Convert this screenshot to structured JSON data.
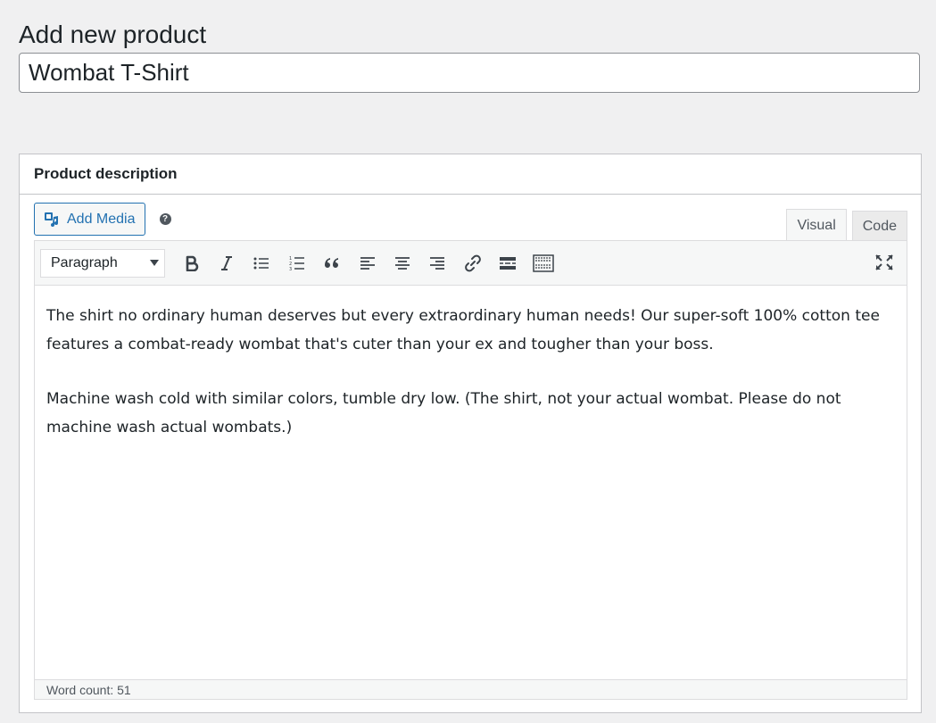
{
  "page": {
    "title": "Add new product"
  },
  "product": {
    "name": "Wombat T-Shirt"
  },
  "description_box": {
    "title": "Product description",
    "add_media_label": "Add Media",
    "help_icon_glyph": "?",
    "tabs": [
      {
        "label": "Visual",
        "active": true
      },
      {
        "label": "Code",
        "active": false
      }
    ],
    "format_select_value": "Paragraph",
    "toolbar_icons": [
      "bold-icon",
      "italic-icon",
      "bulleted-list-icon",
      "numbered-list-icon",
      "blockquote-icon",
      "align-left-icon",
      "align-center-icon",
      "align-right-icon",
      "link-icon",
      "read-more-icon",
      "toolbar-toggle-icon",
      "fullscreen-icon"
    ],
    "paragraphs": [
      "The shirt no ordinary human deserves but every extraordinary human needs! Our super-soft 100% cotton tee features a combat-ready wombat that's cuter than your ex and tougher than your boss.",
      "Machine wash cold with similar colors, tumble dry low. (The shirt, not your actual wombat. Please do not machine wash actual wombats.)"
    ],
    "word_count": "Word count: 51"
  },
  "colors": {
    "accent": "#2271b1",
    "background": "#f0f0f1",
    "text": "#1d2327"
  }
}
